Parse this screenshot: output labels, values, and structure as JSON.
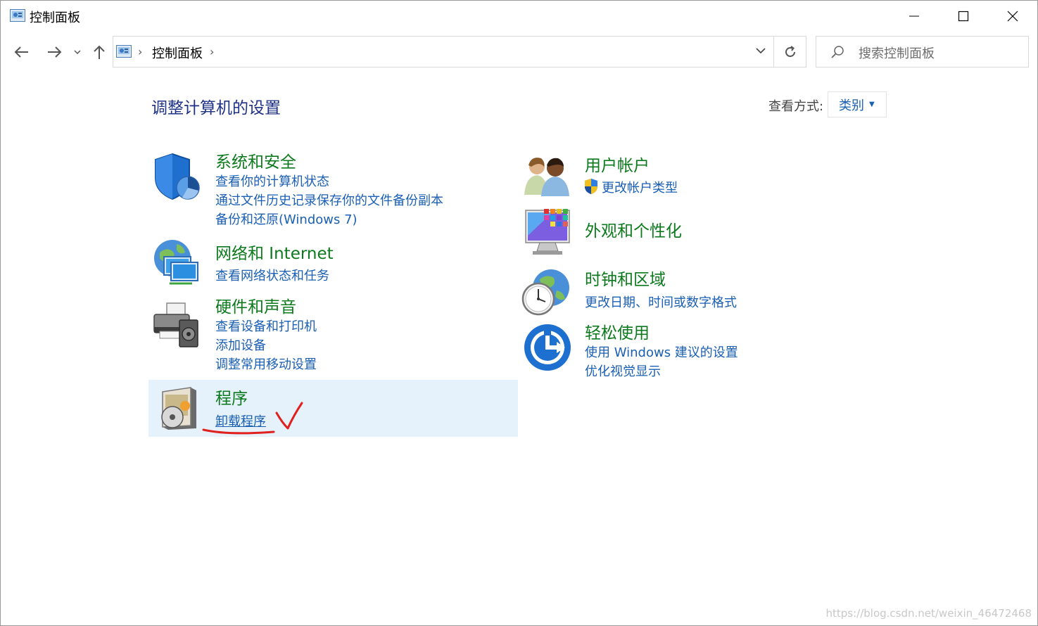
{
  "window": {
    "title": "控制面板",
    "icon": "control-panel-icon",
    "minimize_icon": "minimize-icon",
    "maximize_icon": "maximize-icon",
    "close_icon": "close-icon"
  },
  "nav": {
    "back_icon": "back-arrow-icon",
    "forward_icon": "forward-arrow-icon",
    "recent_icon": "chevron-down-icon",
    "up_icon": "up-arrow-icon",
    "address": {
      "path": "控制面板",
      "icon": "control-panel-icon"
    },
    "refresh_icon": "refresh-icon",
    "search_placeholder": "搜索控制面板"
  },
  "header": {
    "title": "调整计算机的设置",
    "view_by_label": "查看方式:",
    "view_by_value": "类别"
  },
  "categories": [
    {
      "title": "系统和安全",
      "icon": "shield-icon",
      "links": [
        "查看你的计算机状态",
        "通过文件历史记录保存你的文件备份副本",
        "备份和还原(Windows 7)"
      ]
    },
    {
      "title": "网络和 Internet",
      "icon": "network-icon",
      "links": [
        "查看网络状态和任务"
      ]
    },
    {
      "title": "硬件和声音",
      "icon": "printer-icon",
      "links": [
        "查看设备和打印机",
        "添加设备",
        "调整常用移动设置"
      ]
    },
    {
      "title": "程序",
      "icon": "programs-icon",
      "links": [
        "卸载程序"
      ]
    },
    {
      "title": "用户帐户",
      "icon": "users-icon",
      "links": [
        "更改帐户类型"
      ]
    },
    {
      "title": "外观和个性化",
      "icon": "appearance-icon",
      "links": []
    },
    {
      "title": "时钟和区域",
      "icon": "clock-globe-icon",
      "links": [
        "更改日期、时间或数字格式"
      ]
    },
    {
      "title": "轻松使用",
      "icon": "ease-of-access-icon",
      "links": [
        "使用 Windows 建议的设置",
        "优化视觉显示"
      ]
    }
  ],
  "colors": {
    "category_title": "#0c7a1c",
    "link": "#1a5fb4",
    "page_title": "#1e3287",
    "highlight_bg": "#e5f1fb",
    "annotation": "#e0201e"
  },
  "watermark": "https://blog.csdn.net/weixin_46472468"
}
